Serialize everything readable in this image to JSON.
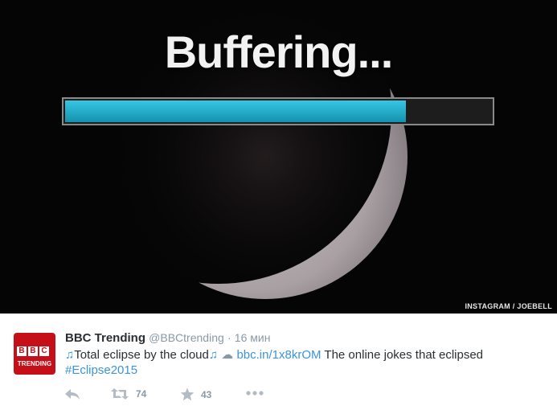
{
  "media": {
    "overlay_text": "Buffering...",
    "progress_fraction": 0.8,
    "credit": "INSTAGRAM / JOEBELL"
  },
  "author": {
    "avatar_logo_letters": [
      "B",
      "B",
      "C"
    ],
    "avatar_subtitle": "TRENDING",
    "name": "BBC Trending",
    "handle": "@BBCtrending",
    "separator": "·",
    "time": "16 мин"
  },
  "tweet": {
    "note_glyph": "♫",
    "text_main": "Total eclipse by the cloud",
    "cloud_glyph": "☁",
    "link": "bbc.in/1x8krOM",
    "text_after_link": "The online jokes that eclipsed",
    "hashtag": "#Eclipse2015"
  },
  "actions": {
    "retweets": "74",
    "favorites": "43",
    "reply_icon": "reply-icon",
    "retweet_icon": "retweet-icon",
    "favorite_icon": "star-icon",
    "more_icon": "more-icon"
  },
  "colors": {
    "link": "#3b94d9",
    "meta_gray": "#8899a6",
    "text": "#292f33",
    "bbc_red": "#c5101a",
    "progress": "#2bb4d2"
  }
}
